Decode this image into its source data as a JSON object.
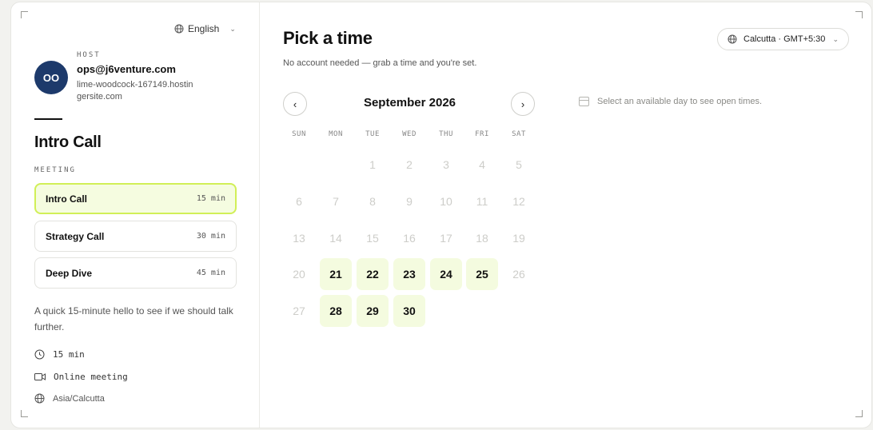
{
  "language": {
    "label": "English"
  },
  "host": {
    "label": "HOST",
    "initials": "OO",
    "email": "ops@j6venture.com",
    "site": "lime-woodcock-167149.hostingersite.com"
  },
  "event_title": "Intro Call",
  "meeting_label": "MEETING",
  "event_types": [
    {
      "name": "Intro Call",
      "duration": "15 min",
      "selected": true
    },
    {
      "name": "Strategy Call",
      "duration": "30 min",
      "selected": false
    },
    {
      "name": "Deep Dive",
      "duration": "45 min",
      "selected": false
    }
  ],
  "description": "A quick 15-minute hello to see if we should talk further.",
  "details": {
    "duration": "15 min",
    "location": "Online meeting",
    "timezone": "Asia/Calcutta"
  },
  "header": {
    "title": "Pick a time",
    "subtitle": "No account needed — grab a time and you're set.",
    "timezone_button": "Calcutta · GMT+5:30"
  },
  "calendar": {
    "month_label": "September 2026",
    "weekdays": [
      "SUN",
      "MON",
      "TUE",
      "WED",
      "THU",
      "FRI",
      "SAT"
    ],
    "weeks": [
      [
        null,
        null,
        1,
        2,
        3,
        4,
        5
      ],
      [
        6,
        7,
        8,
        9,
        10,
        11,
        12
      ],
      [
        13,
        14,
        15,
        16,
        17,
        18,
        19
      ],
      [
        20,
        21,
        22,
        23,
        24,
        25,
        26
      ],
      [
        27,
        28,
        29,
        30,
        null,
        null,
        null
      ]
    ],
    "available_days": [
      21,
      22,
      23,
      24,
      25,
      28,
      29,
      30
    ]
  },
  "hint": "Select an available day to see open times.",
  "colors": {
    "accent_border": "#d1ef57",
    "accent_bg": "#f5fce0",
    "avatar_bg": "#1d3a6b"
  }
}
